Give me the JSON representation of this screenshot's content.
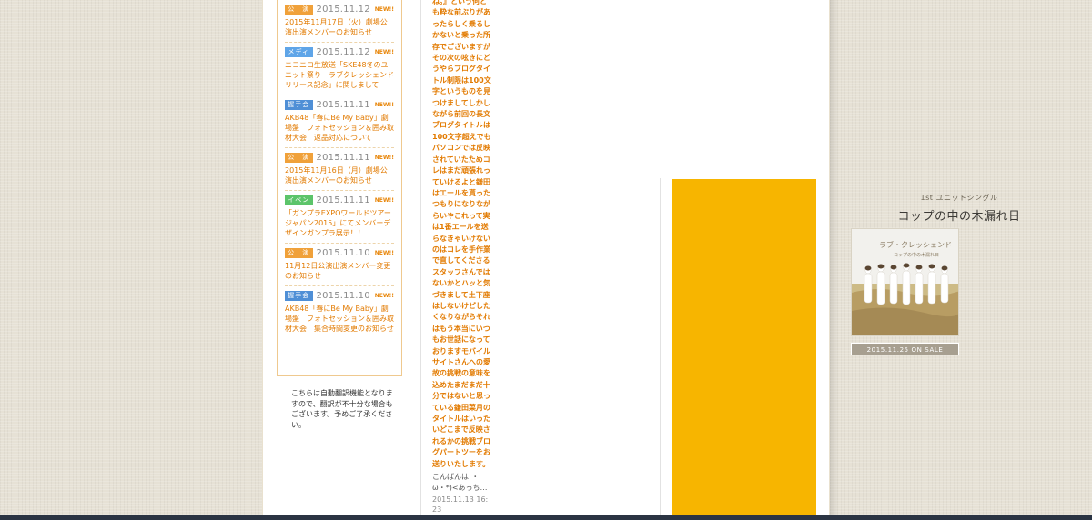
{
  "news": [
    {
      "category": "公　演",
      "color": "#f0a13a",
      "date": "2015.11.12",
      "badge": "NEW!!",
      "title": "2015年11月17日（火）劇場公演出演メンバーのお知らせ"
    },
    {
      "category": "メディア",
      "color": "#5fa5e8",
      "date": "2015.11.12",
      "badge": "NEW!!",
      "title": "ニコニコ生放送「SKE48冬のユニット祭り　ラブクレッシェンドリリース記念」に関しまして"
    },
    {
      "category": "握手会",
      "color": "#4f8fd6",
      "date": "2015.11.11",
      "badge": "NEW!!",
      "title": "AKB48「春にBe My Baby」劇場盤　フォトセッション＆囲み取材大会　返品対応について"
    },
    {
      "category": "公　演",
      "color": "#f0a13a",
      "date": "2015.11.11",
      "badge": "NEW!!",
      "title": "2015年11月16日（月）劇場公演出演メンバーのお知らせ"
    },
    {
      "category": "イベント",
      "color": "#5cc46a",
      "date": "2015.11.11",
      "badge": "NEW!!",
      "title": "「ガンプラEXPOワールドツアージャパン2015」にてメンバーデザインガンプラ展示！！"
    },
    {
      "category": "公　演",
      "color": "#f0a13a",
      "date": "2015.11.10",
      "badge": "NEW!!",
      "title": "11月12日公演出演メンバー変更のお知らせ"
    },
    {
      "category": "握手会",
      "color": "#4f8fd6",
      "date": "2015.11.10",
      "badge": "NEW!!",
      "title": "AKB48「春にBe My Baby」劇場盤　フォトセッション＆囲み取材大会　集合時間変更のお知らせ"
    }
  ],
  "disclaimer": "こちらは自動翻訳機能となりますので、翻訳が不十分な場合もございます。予めご了承ください。",
  "blog": {
    "text": "ね。』という何とも粋な前ぶりがあったらしく乗るしかないと乗った所存でございますがその次の呟きにどうやらブログタイトル制限は100文字というものを見つけましてしかしながら前回の長文ブログタイトルは100文字超えでもパソコンでは反映されていたためコレはまだ頑張れっていけるよと鎌田はエールを貰ったつもりになりながらいやこれって実は1番エールを送らなきゃいけないのはコレを手作業で直してくださるスタッフさんではないかとハッと気づきまして土下座はしないけどしたくなりながらそれはもう本当にいつもお世話になっておりますモバイルサイトさんへの愛故の挑戦の意味を込めたまだまだ十分ではないと思っている鎌田菜月のタイトルはいったいどこまで反映されるかの挑戦ブログパートツーをお送りいたします。",
    "next": "こんばんは!・ω・*)<あっち…",
    "date": "2015.11.13 16:23"
  },
  "promo": {
    "subtitle": "1st ユニットシングル",
    "title": "コップの中の木漏れ日",
    "jacket_text": "ラブ・クレッシェンド",
    "jacket_subtext": "コップの中の木漏れ日",
    "sale": "2015.11.25 ON SALE"
  }
}
